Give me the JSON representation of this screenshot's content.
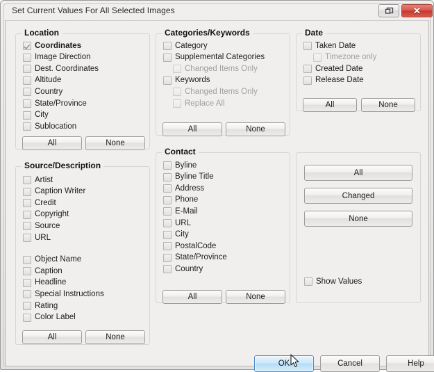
{
  "window": {
    "title": "Set Current Values For All Selected Images",
    "restore_icon": "restore-windows-icon",
    "close_label": "✕"
  },
  "groups": {
    "location": {
      "title": "Location",
      "items": [
        {
          "label": "Coordinates",
          "checked": true,
          "bold": true,
          "disabled": false,
          "indent": 0
        },
        {
          "label": "Image Direction",
          "checked": false,
          "bold": false,
          "disabled": false,
          "indent": 0
        },
        {
          "label": "Dest. Coordinates",
          "checked": false,
          "bold": false,
          "disabled": false,
          "indent": 0
        },
        {
          "label": "Altitude",
          "checked": false,
          "bold": false,
          "disabled": false,
          "indent": 0
        },
        {
          "label": "Country",
          "checked": false,
          "bold": false,
          "disabled": false,
          "indent": 0
        },
        {
          "label": "State/Province",
          "checked": false,
          "bold": false,
          "disabled": false,
          "indent": 0
        },
        {
          "label": "City",
          "checked": false,
          "bold": false,
          "disabled": false,
          "indent": 0
        },
        {
          "label": "Sublocation",
          "checked": false,
          "bold": false,
          "disabled": false,
          "indent": 0
        }
      ],
      "all_label": "All",
      "none_label": "None"
    },
    "source_description": {
      "title": "Source/Description",
      "items": [
        {
          "label": "Artist",
          "checked": false,
          "bold": false,
          "disabled": false,
          "indent": 0
        },
        {
          "label": "Caption Writer",
          "checked": false,
          "bold": false,
          "disabled": false,
          "indent": 0
        },
        {
          "label": "Credit",
          "checked": false,
          "bold": false,
          "disabled": false,
          "indent": 0
        },
        {
          "label": "Copyright",
          "checked": false,
          "bold": false,
          "disabled": false,
          "indent": 0
        },
        {
          "label": "Source",
          "checked": false,
          "bold": false,
          "disabled": false,
          "indent": 0
        },
        {
          "label": "URL",
          "checked": false,
          "bold": false,
          "disabled": false,
          "indent": 0
        },
        {
          "label": "Object Name",
          "checked": false,
          "bold": false,
          "disabled": false,
          "indent": 0
        },
        {
          "label": "Caption",
          "checked": false,
          "bold": false,
          "disabled": false,
          "indent": 0
        },
        {
          "label": "Headline",
          "checked": false,
          "bold": false,
          "disabled": false,
          "indent": 0
        },
        {
          "label": "Special Instructions",
          "checked": false,
          "bold": false,
          "disabled": false,
          "indent": 0
        },
        {
          "label": "Rating",
          "checked": false,
          "bold": false,
          "disabled": false,
          "indent": 0
        },
        {
          "label": "Color Label",
          "checked": false,
          "bold": false,
          "disabled": false,
          "indent": 0
        }
      ],
      "all_label": "All",
      "none_label": "None"
    },
    "categories_keywords": {
      "title": "Categories/Keywords",
      "items": [
        {
          "label": "Category",
          "checked": false,
          "bold": false,
          "disabled": false,
          "indent": 0
        },
        {
          "label": "Supplemental Categories",
          "checked": false,
          "bold": false,
          "disabled": false,
          "indent": 0
        },
        {
          "label": "Changed Items Only",
          "checked": false,
          "bold": false,
          "disabled": true,
          "indent": 1
        },
        {
          "label": "Keywords",
          "checked": false,
          "bold": false,
          "disabled": false,
          "indent": 0
        },
        {
          "label": "Changed Items Only",
          "checked": false,
          "bold": false,
          "disabled": true,
          "indent": 1
        },
        {
          "label": "Replace All",
          "checked": false,
          "bold": false,
          "disabled": true,
          "indent": 1
        }
      ],
      "all_label": "All",
      "none_label": "None"
    },
    "contact": {
      "title": "Contact",
      "items": [
        {
          "label": "Byline",
          "checked": false,
          "bold": false,
          "disabled": false,
          "indent": 0
        },
        {
          "label": "Byline Title",
          "checked": false,
          "bold": false,
          "disabled": false,
          "indent": 0
        },
        {
          "label": "Address",
          "checked": false,
          "bold": false,
          "disabled": false,
          "indent": 0
        },
        {
          "label": "Phone",
          "checked": false,
          "bold": false,
          "disabled": false,
          "indent": 0
        },
        {
          "label": "E-Mail",
          "checked": false,
          "bold": false,
          "disabled": false,
          "indent": 0
        },
        {
          "label": "URL",
          "checked": false,
          "bold": false,
          "disabled": false,
          "indent": 0
        },
        {
          "label": "City",
          "checked": false,
          "bold": false,
          "disabled": false,
          "indent": 0
        },
        {
          "label": "PostalCode",
          "checked": false,
          "bold": false,
          "disabled": false,
          "indent": 0
        },
        {
          "label": "State/Province",
          "checked": false,
          "bold": false,
          "disabled": false,
          "indent": 0
        },
        {
          "label": "Country",
          "checked": false,
          "bold": false,
          "disabled": false,
          "indent": 0
        }
      ],
      "all_label": "All",
      "none_label": "None"
    },
    "date": {
      "title": "Date",
      "items": [
        {
          "label": "Taken Date",
          "checked": false,
          "bold": false,
          "disabled": false,
          "indent": 0
        },
        {
          "label": "Timezone only",
          "checked": false,
          "bold": false,
          "disabled": true,
          "indent": 1
        },
        {
          "label": "Created Date",
          "checked": false,
          "bold": false,
          "disabled": false,
          "indent": 0
        },
        {
          "label": "Release Date",
          "checked": false,
          "bold": false,
          "disabled": false,
          "indent": 0
        }
      ],
      "all_label": "All",
      "none_label": "None"
    },
    "global": {
      "title": "",
      "all_label": "All",
      "changed_label": "Changed",
      "none_label": "None",
      "show_values": {
        "label": "Show Values",
        "checked": false
      }
    }
  },
  "footer": {
    "ok_label": "OK",
    "cancel_label": "Cancel",
    "help_label": "Help"
  }
}
